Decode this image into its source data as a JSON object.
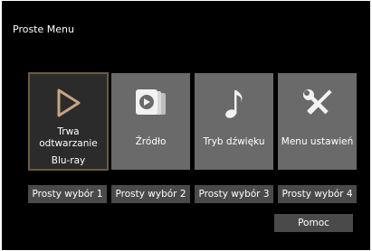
{
  "menu": {
    "title": "Proste Menu",
    "tiles": [
      {
        "label": "Trwa odtwarzanie",
        "sublabel": "Blu-ray",
        "icon": "play-icon",
        "selected": true
      },
      {
        "label": "Źródło",
        "icon": "source-icon",
        "selected": false
      },
      {
        "label": "Tryb dźwięku",
        "icon": "music-note-icon",
        "selected": false
      },
      {
        "label": "Menu ustawień",
        "icon": "tools-icon",
        "selected": false
      }
    ],
    "quick_select": [
      "Prosty wybór 1",
      "Prosty wybór 2",
      "Prosty wybór 3",
      "Prosty wybór 4"
    ],
    "help_label": "Pomoc"
  },
  "colors": {
    "background": "#000000",
    "tile": "#6a6a6a",
    "tile_selected": "#2b2b2b",
    "selected_border": "#6d5a42",
    "play_icon": "#c9a483",
    "button": "#4a4a4a",
    "text": "#ffffff"
  }
}
